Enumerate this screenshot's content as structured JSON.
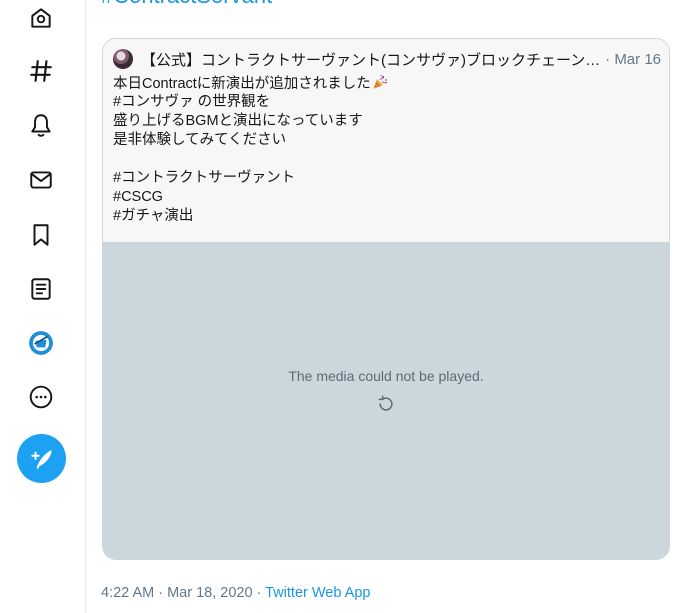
{
  "top_hashtag": "#ContractServant",
  "nav": {
    "home_icon": "home-icon",
    "explore_icon": "hashtag-icon",
    "notifications_icon": "bell-icon",
    "messages_icon": "mail-icon",
    "bookmarks_icon": "bookmark-icon",
    "lists_icon": "list-icon",
    "profile_icon": "profile-avatar-icon",
    "more_icon": "more-icon",
    "compose_icon": "compose-tweet-icon"
  },
  "quoted_tweet": {
    "author": "【公式】コントラクトサーヴァント(コンサヴァ)ブロックチェーンゲーム",
    "separator": "·",
    "date": "Mar 16",
    "lines": [
      "本日Contractに新演出が追加されました",
      "#コンサヴァ の世界観を",
      "盛り上げるBGMと演出になっています",
      "是非体験してみてください",
      "",
      "#コントラクトサーヴァント",
      "#CSCG",
      "#ガチャ演出"
    ],
    "emoji": "party-popper-icon",
    "media_message": "The media could not be played."
  },
  "footer": {
    "timestamp": "4:22 AM · Mar 18, 2020",
    "separator": " · ",
    "source": "Twitter Web App"
  },
  "colors": {
    "accent": "#1da1f2",
    "link": "#1b95e0",
    "muted": "#657786",
    "media_bg": "#ccd6dd"
  }
}
